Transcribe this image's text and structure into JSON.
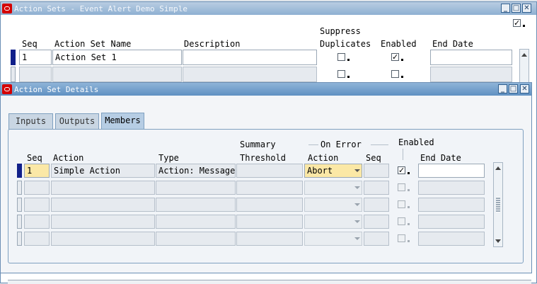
{
  "action_sets_window": {
    "title": "Action Sets - Event Alert Demo Simple",
    "headers": {
      "seq": "Seq",
      "name": "Action Set Name",
      "description": "Description",
      "suppress_line1": "Suppress",
      "suppress_line2": "Duplicates",
      "enabled": "Enabled",
      "end_date": "End Date"
    },
    "rows": [
      {
        "seq": "1",
        "name": "Action Set 1",
        "description": "",
        "suppress_duplicates": false,
        "enabled": true,
        "end_date": ""
      },
      {
        "seq": "",
        "name": "",
        "description": "",
        "suppress_duplicates": false,
        "enabled": true,
        "end_date": ""
      }
    ],
    "top_checkbox_checked": true
  },
  "details_window": {
    "title": "Action Set Details",
    "tabs": [
      {
        "label": "Inputs",
        "active": false
      },
      {
        "label": "Outputs",
        "active": false
      },
      {
        "label": "Members",
        "active": true
      }
    ],
    "headers": {
      "seq": "Seq",
      "action": "Action",
      "type": "Type",
      "summary_line1": "Summary",
      "summary_line2": "Threshold",
      "on_error_group": "On Error",
      "on_error_action": "Action",
      "on_error_seq": "Seq",
      "enabled": "Enabled",
      "end_date": "End Date"
    },
    "rows": [
      {
        "seq": "1",
        "action": "Simple Action",
        "type": "Action: Message",
        "summary_threshold": "",
        "on_error_action": "Abort",
        "on_error_seq": "",
        "enabled": true,
        "end_date": ""
      },
      {
        "seq": "",
        "action": "",
        "type": "",
        "summary_threshold": "",
        "on_error_action": "",
        "on_error_seq": "",
        "enabled": false,
        "end_date": ""
      },
      {
        "seq": "",
        "action": "",
        "type": "",
        "summary_threshold": "",
        "on_error_action": "",
        "on_error_seq": "",
        "enabled": false,
        "end_date": ""
      },
      {
        "seq": "",
        "action": "",
        "type": "",
        "summary_threshold": "",
        "on_error_action": "",
        "on_error_seq": "",
        "enabled": false,
        "end_date": ""
      },
      {
        "seq": "",
        "action": "",
        "type": "",
        "summary_threshold": "",
        "on_error_action": "",
        "on_error_seq": "",
        "enabled": false,
        "end_date": ""
      }
    ]
  },
  "icons": {
    "window_logo": "oracle-logo-icon",
    "minimize": "minimize-icon",
    "maximize": "maximize-icon",
    "close": "close-icon",
    "scroll_up": "scroll-up-arrow-icon",
    "scroll_down": "scroll-down-arrow-icon",
    "dropdown": "chevron-down-icon"
  },
  "colors": {
    "titlebar": "#5f90c2",
    "current_record": "#11208a",
    "highlight_field": "#fbe8a6",
    "logo": "#d40000"
  }
}
